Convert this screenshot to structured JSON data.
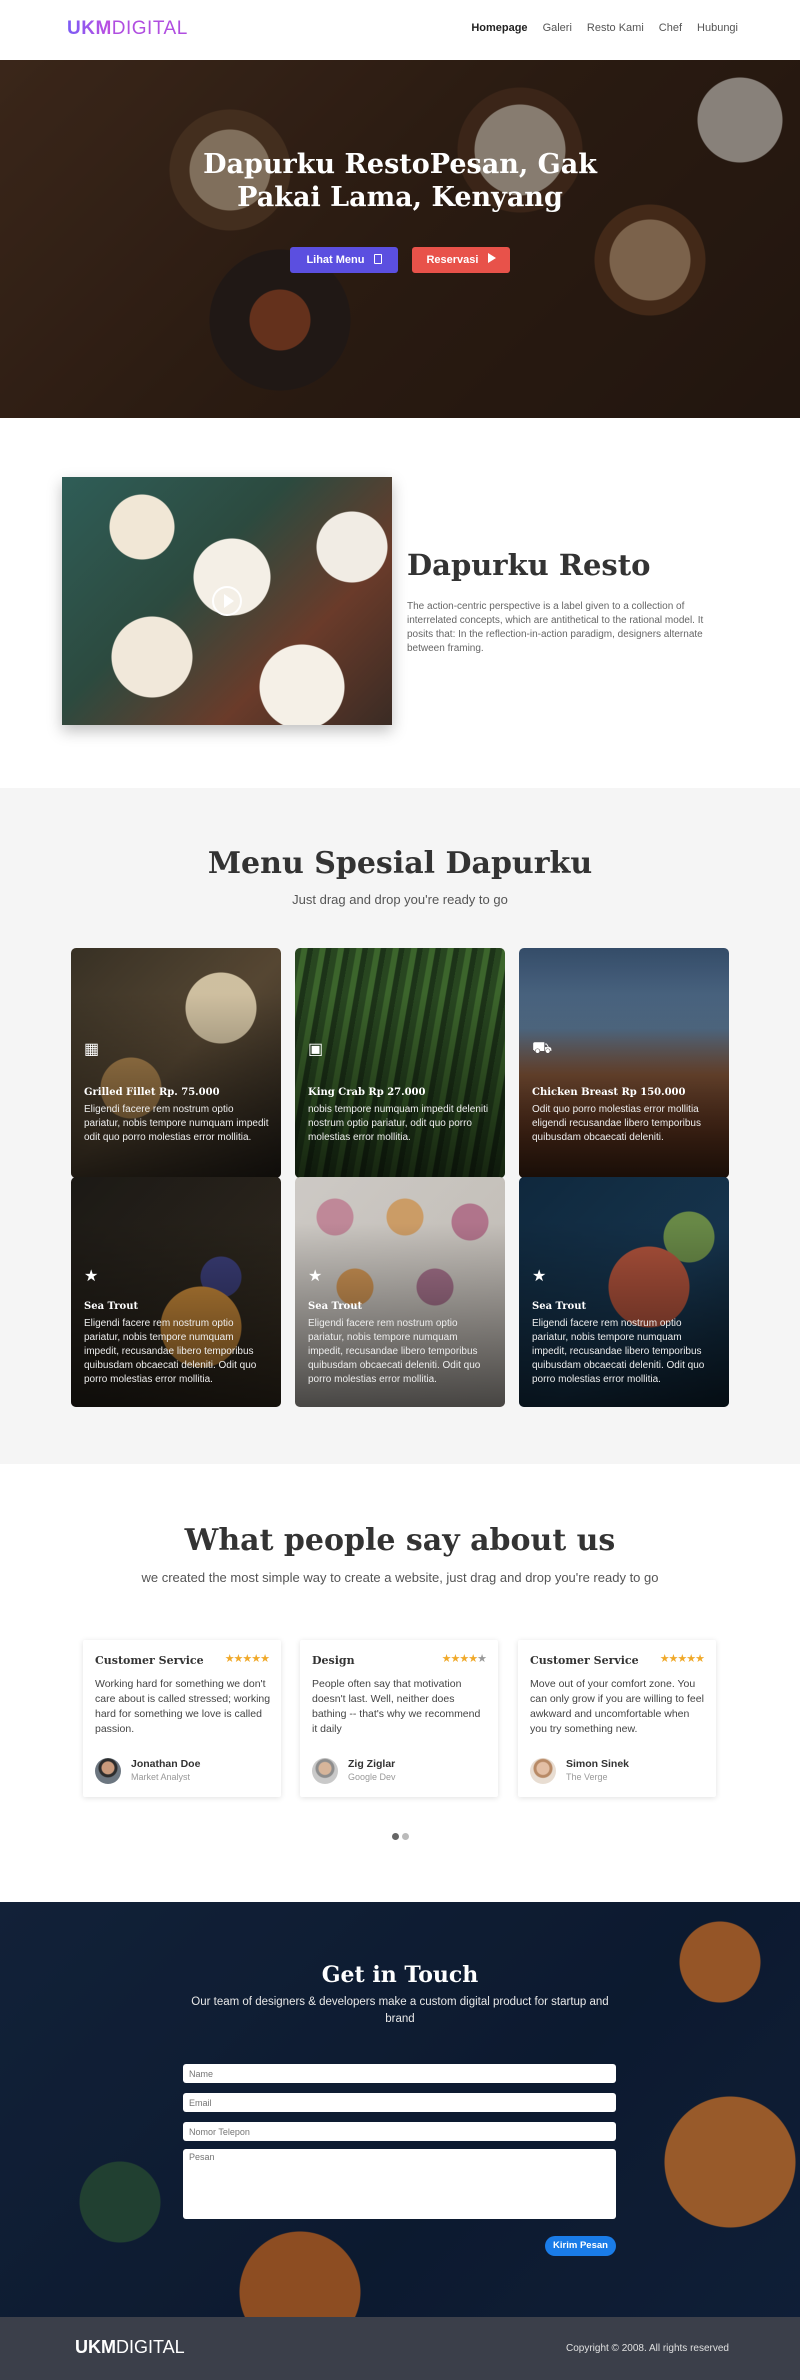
{
  "nav": {
    "logo_bold": "UKM",
    "logo_light": "DIGITAL",
    "links": [
      "Homepage",
      "Galeri",
      "Resto Kami",
      "Chef",
      "Hubungi"
    ]
  },
  "hero": {
    "title": "Dapurku RestoPesan, Gak Pakai Lama, Kenyang",
    "btn_menu": "Lihat Menu",
    "btn_reserve": "Reservasi",
    "btn_menu_icon": "book-icon",
    "btn_reserve_icon": "play-icon"
  },
  "about": {
    "title": "Dapurku Resto",
    "text": "The action-centric perspective is a label given to a collection of interrelated concepts, which are antithetical to the rational model. It posits that: In the reflection-in-action paradigm, designers alternate between framing."
  },
  "menu": {
    "title": "Menu Spesial Dapurku",
    "subtitle": "Just drag and drop you're ready to go",
    "items": [
      {
        "icon": "grid-icon",
        "title": "Grilled Fillet Rp. 75.000",
        "desc": "Eligendi facere rem nostrum optio pariatur, nobis tempore numquam impedit odit quo porro molestias error mollitia."
      },
      {
        "icon": "monitor-icon",
        "title": "King Crab Rp 27.000",
        "desc": "nobis tempore numquam impedit deleniti nostrum optio pariatur, odit quo porro molestias error mollitia."
      },
      {
        "icon": "truck-icon",
        "title": "Chicken Breast Rp 150.000",
        "desc": "Odit quo porro molestias error mollitia eligendi recusandae libero temporibus quibusdam obcaecati deleniti."
      },
      {
        "icon": "star-icon",
        "title": "Sea Trout",
        "desc": "Eligendi facere rem nostrum optio pariatur, nobis tempore numquam impedit, recusandae libero temporibus quibusdam obcaecati deleniti. Odit quo porro molestias error mollitia."
      },
      {
        "icon": "star-icon",
        "title": "Sea Trout",
        "desc": "Eligendi facere rem nostrum optio pariatur, nobis tempore numquam impedit, recusandae libero temporibus quibusdam obcaecati deleniti. Odit quo porro molestias error mollitia."
      },
      {
        "icon": "star-icon",
        "title": "Sea Trout",
        "desc": "Eligendi facere rem nostrum optio pariatur, nobis tempore numquam impedit, recusandae libero temporibus quibusdam obcaecati deleniti. Odit quo porro molestias error mollitia."
      }
    ]
  },
  "testimonials": {
    "title": "What people say about us",
    "subtitle": "we created the most simple way to create a website, just drag and drop you're ready to go",
    "items": [
      {
        "category": "Customer Service",
        "rating": 5,
        "text": "Working hard for something we don't care about is called stressed; working hard for something we love is called passion.",
        "name": "Jonathan Doe",
        "role": "Market Analyst"
      },
      {
        "category": "Design",
        "rating": 4,
        "text": "People often say that motivation doesn't last. Well, neither does bathing -- that's why we recommend it daily",
        "name": "Zig Ziglar",
        "role": "Google Dev"
      },
      {
        "category": "Customer Service",
        "rating": 5,
        "text": "Move out of your comfort zone. You can only grow if you are willing to feel awkward and uncomfortable when you try something new.",
        "name": "Simon Sinek",
        "role": "The Verge"
      }
    ]
  },
  "contact": {
    "title": "Get in Touch",
    "subtitle": "Our team of designers & developers make a custom digital product for startup and brand",
    "name_placeholder": "Name",
    "email_placeholder": "Email",
    "phone_placeholder": "Nomor Telepon",
    "message_placeholder": "Pesan",
    "submit": "Kirim Pesan"
  },
  "footer": {
    "logo_bold": "UKM",
    "logo_light": "DIGITAL",
    "copyright": "Copyright © 2008. All rights reserved"
  },
  "colors": {
    "primary": "#5b4fe0",
    "danger": "#e8524a",
    "send": "#1a7ce8",
    "star": "#f0a92a",
    "footer": "#3b3f4a"
  }
}
